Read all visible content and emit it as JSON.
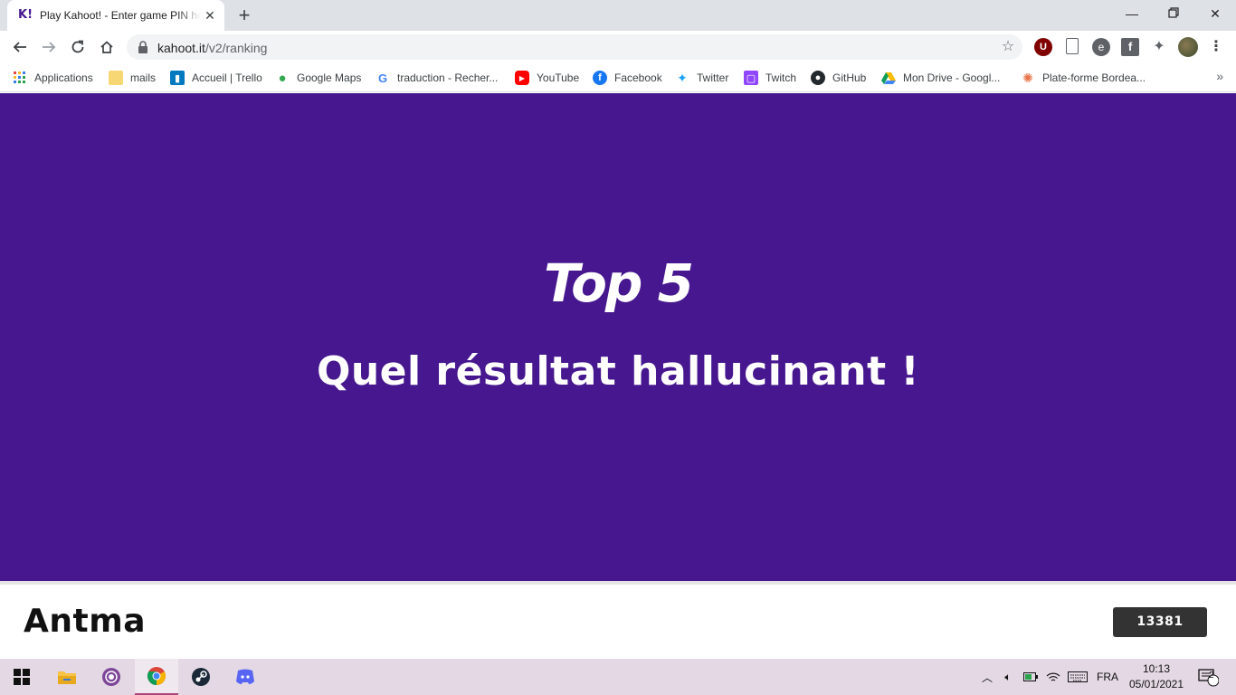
{
  "browser": {
    "tab_title": "Play Kahoot! - Enter game PIN here!",
    "tab_favicon": "K!",
    "url_host": "kahoot.it",
    "url_path": "/v2/ranking",
    "bookmarks": [
      {
        "label": "Applications",
        "icon": "apps-grid-icon"
      },
      {
        "label": "mails",
        "icon": "folder-icon"
      },
      {
        "label": "Accueil | Trello",
        "icon": "trello-icon"
      },
      {
        "label": "Google Maps",
        "icon": "maps-pin-icon"
      },
      {
        "label": "traduction - Recher...",
        "icon": "google-icon"
      },
      {
        "label": "YouTube",
        "icon": "youtube-icon"
      },
      {
        "label": "Facebook",
        "icon": "facebook-icon"
      },
      {
        "label": "Twitter",
        "icon": "twitter-icon"
      },
      {
        "label": "Twitch",
        "icon": "twitch-icon"
      },
      {
        "label": "GitHub",
        "icon": "github-icon"
      },
      {
        "label": "Mon Drive - Googl...",
        "icon": "drive-icon"
      },
      {
        "label": "Plate-forme Bordea...",
        "icon": "platform-icon"
      }
    ],
    "bookmarks_more": "»"
  },
  "page": {
    "title": "Top 5",
    "subtitle": "Quel résultat hallucinant !",
    "player_name": "Antma",
    "score": "13381",
    "colors": {
      "background": "#46178f",
      "score_badge": "#333333"
    }
  },
  "taskbar": {
    "language": "FRA",
    "time": "10:13",
    "date": "05/01/2021",
    "notifications_count": "2"
  }
}
